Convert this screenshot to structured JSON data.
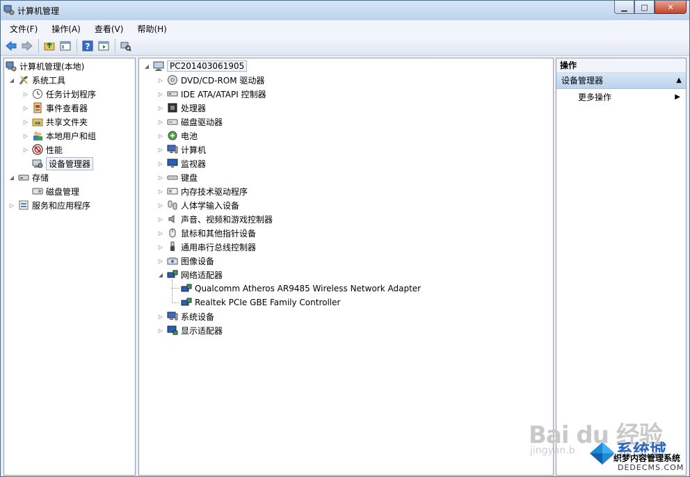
{
  "window": {
    "title": "计算机管理"
  },
  "menu": [
    "文件(F)",
    "操作(A)",
    "查看(V)",
    "帮助(H)"
  ],
  "left_tree": {
    "root": "计算机管理(本地)",
    "system_tools": "系统工具",
    "system_items": [
      "任务计划程序",
      "事件查看器",
      "共享文件夹",
      "本地用户和组",
      "性能",
      "设备管理器"
    ],
    "storage": "存储",
    "storage_items": [
      "磁盘管理"
    ],
    "services": "服务和应用程序"
  },
  "device_tree": {
    "computer": "PC201403061905",
    "categories": [
      "DVD/CD-ROM 驱动器",
      "IDE ATA/ATAPI 控制器",
      "处理器",
      "磁盘驱动器",
      "电池",
      "计算机",
      "监视器",
      "键盘",
      "内存技术驱动程序",
      "人体学输入设备",
      "声音、视频和游戏控制器",
      "鼠标和其他指针设备",
      "通用串行总线控制器",
      "图像设备",
      "网络适配器"
    ],
    "network_adapters": [
      "Qualcomm Atheros AR9485 Wireless Network Adapter",
      "Realtek PCIe GBE Family Controller"
    ],
    "after": [
      "系统设备",
      "显示适配器"
    ]
  },
  "actions": {
    "header": "操作",
    "section": "设备管理器",
    "more": "更多操作"
  },
  "watermark": {
    "baidu": "Bai du 经验",
    "jingyan": "jingyan.b",
    "xitong": "系统城",
    "dede": "织梦内容管理系统",
    "dedecms": "DEDECMS.COM"
  }
}
